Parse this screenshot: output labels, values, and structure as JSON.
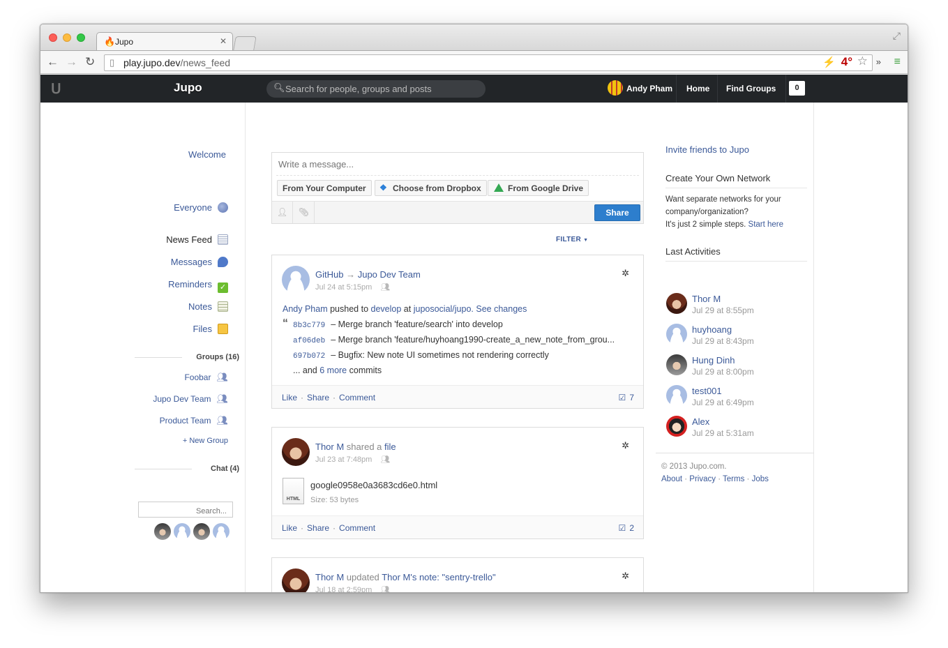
{
  "browser": {
    "tab_title": "Jupo",
    "url_host": "play.jupo.dev",
    "url_path": "/news_feed",
    "weather": "4°"
  },
  "header": {
    "app_title": "Jupo",
    "search_placeholder": "Search for people, groups and posts",
    "user_name": "Andy Pham",
    "nav": [
      "Home",
      "Find Groups"
    ],
    "notifications": "0"
  },
  "sidebar": {
    "welcome": "Welcome",
    "everyone": "Everyone",
    "items": [
      {
        "label": "News Feed",
        "icon": "news-feed-icon",
        "active": true
      },
      {
        "label": "Messages",
        "icon": "messages-icon"
      },
      {
        "label": "Reminders",
        "icon": "reminders-icon"
      },
      {
        "label": "Notes",
        "icon": "notes-icon"
      },
      {
        "label": "Files",
        "icon": "files-icon"
      }
    ],
    "groups_header": "Groups (16)",
    "groups": [
      "Foobar",
      "Jupo Dev Team",
      "Product Team"
    ],
    "new_group": "+ New Group",
    "chat_header": "Chat (4)",
    "chat_search_placeholder": "Search..."
  },
  "composer": {
    "placeholder": "Write a message...",
    "attach_buttons": [
      "From Your Computer",
      "Choose from Dropbox",
      "From Google Drive"
    ],
    "share_label": "Share"
  },
  "filter_label": "FILTER",
  "feed": [
    {
      "actor": "GitHub",
      "arrow": "→",
      "target": "Jupo Dev Team",
      "time": "Jul 24 at 5:15pm",
      "summary": {
        "user": "Andy Pham",
        "verb": "pushed to",
        "branch": "develop",
        "at": "at",
        "repo": "juposocial/jupo.",
        "see": "See changes"
      },
      "commits": [
        {
          "sha": "8b3c779",
          "msg": "– Merge branch 'feature/search' into develop"
        },
        {
          "sha": "af06deb",
          "msg": "– Merge branch 'feature/huyhoang1990-create_a_new_note_from_grou..."
        },
        {
          "sha": "697b072",
          "msg": "– Bugfix: New note UI sometimes not rendering correctly"
        }
      ],
      "more": {
        "prefix": "... and",
        "link": "6 more",
        "suffix": "commits"
      },
      "actions": [
        "Like",
        "Share",
        "Comment"
      ],
      "count": "7"
    },
    {
      "actor": "Thor M",
      "verb": "shared a",
      "object": "file",
      "time": "Jul 23 at 7:48pm",
      "file_name": "google0958e0a3683cd6e0.html",
      "file_type": "HTML",
      "file_size": "Size: 53 bytes",
      "actions": [
        "Like",
        "Share",
        "Comment"
      ],
      "count": "2"
    },
    {
      "actor": "Thor M",
      "verb": "updated",
      "object": "Thor M's note: \"sentry-trello\"",
      "time": "Jul 18 at 2:59pm"
    }
  ],
  "right": {
    "invite": "Invite friends to Jupo",
    "network_header": "Create Your Own Network",
    "network_text_1": "Want separate networks for your",
    "network_text_2": "company/organization?",
    "network_text_3": "It's just 2 simple steps.",
    "network_link": "Start here",
    "activities_header": "Last Activities",
    "activities": [
      {
        "name": "Thor M",
        "time": "Jul 29 at 8:55pm"
      },
      {
        "name": "huyhoang",
        "time": "Jul 29 at 8:43pm"
      },
      {
        "name": "Hung Dinh",
        "time": "Jul 29 at 8:00pm"
      },
      {
        "name": "test001",
        "time": "Jul 29 at 6:49pm"
      },
      {
        "name": "Alex",
        "time": "Jul 29 at 5:31am"
      }
    ],
    "copyright": "© 2013 Jupo.com.",
    "footer_links": [
      "About",
      "Privacy",
      "Terms",
      "Jobs"
    ]
  }
}
